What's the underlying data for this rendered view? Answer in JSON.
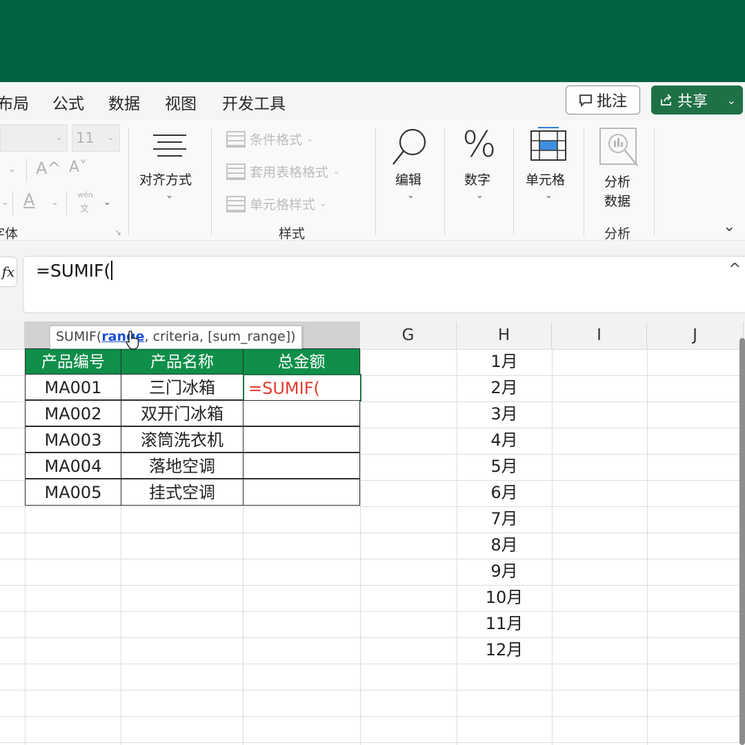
{
  "menu": {
    "tabs": [
      "布局",
      "公式",
      "数据",
      "视图",
      "开发工具"
    ],
    "comment_label": "批注",
    "share_label": "共享"
  },
  "ribbon": {
    "font": {
      "size": "11",
      "group_label": "字体",
      "grow_label": "A^",
      "shrink_label": "A˅",
      "color_label": "A",
      "phonetic_top": "wén",
      "phonetic_bottom": "文"
    },
    "align": {
      "label": "对齐方式"
    },
    "styles": {
      "items": [
        "条件格式",
        "套用表格格式",
        "单元格样式"
      ],
      "group_label": "样式"
    },
    "edit": {
      "label": "编辑"
    },
    "number": {
      "label": "数字"
    },
    "cells": {
      "label": "单元格"
    },
    "analysis": {
      "btn_line1": "分析",
      "btn_line2": "数据",
      "group_label": "分析"
    }
  },
  "formula_bar": {
    "fx": "fx",
    "value": "=SUMIF("
  },
  "tooltip": {
    "prefix": "SUMIF(",
    "current_arg": "range",
    "rest": ", criteria, [sum_range])"
  },
  "columns": [
    "G",
    "H",
    "I",
    "J"
  ],
  "table": {
    "headers": [
      "产品编号",
      "产品名称",
      "总金额"
    ],
    "rows": [
      [
        "MA001",
        "三门冰箱",
        "=SUMIF("
      ],
      [
        "MA002",
        "双开门冰箱",
        ""
      ],
      [
        "MA003",
        "滚筒洗衣机",
        ""
      ],
      [
        "MA004",
        "落地空调",
        ""
      ],
      [
        "MA005",
        "挂式空调",
        ""
      ]
    ]
  },
  "months": [
    "1月",
    "2月",
    "3月",
    "4月",
    "5月",
    "6月",
    "7月",
    "8月",
    "9月",
    "10月",
    "11月",
    "12月"
  ],
  "colors": {
    "title_bar": "#006142",
    "table_header": "#0f8f49",
    "share_button": "#1e7145",
    "active_text": "#e23a2a"
  }
}
